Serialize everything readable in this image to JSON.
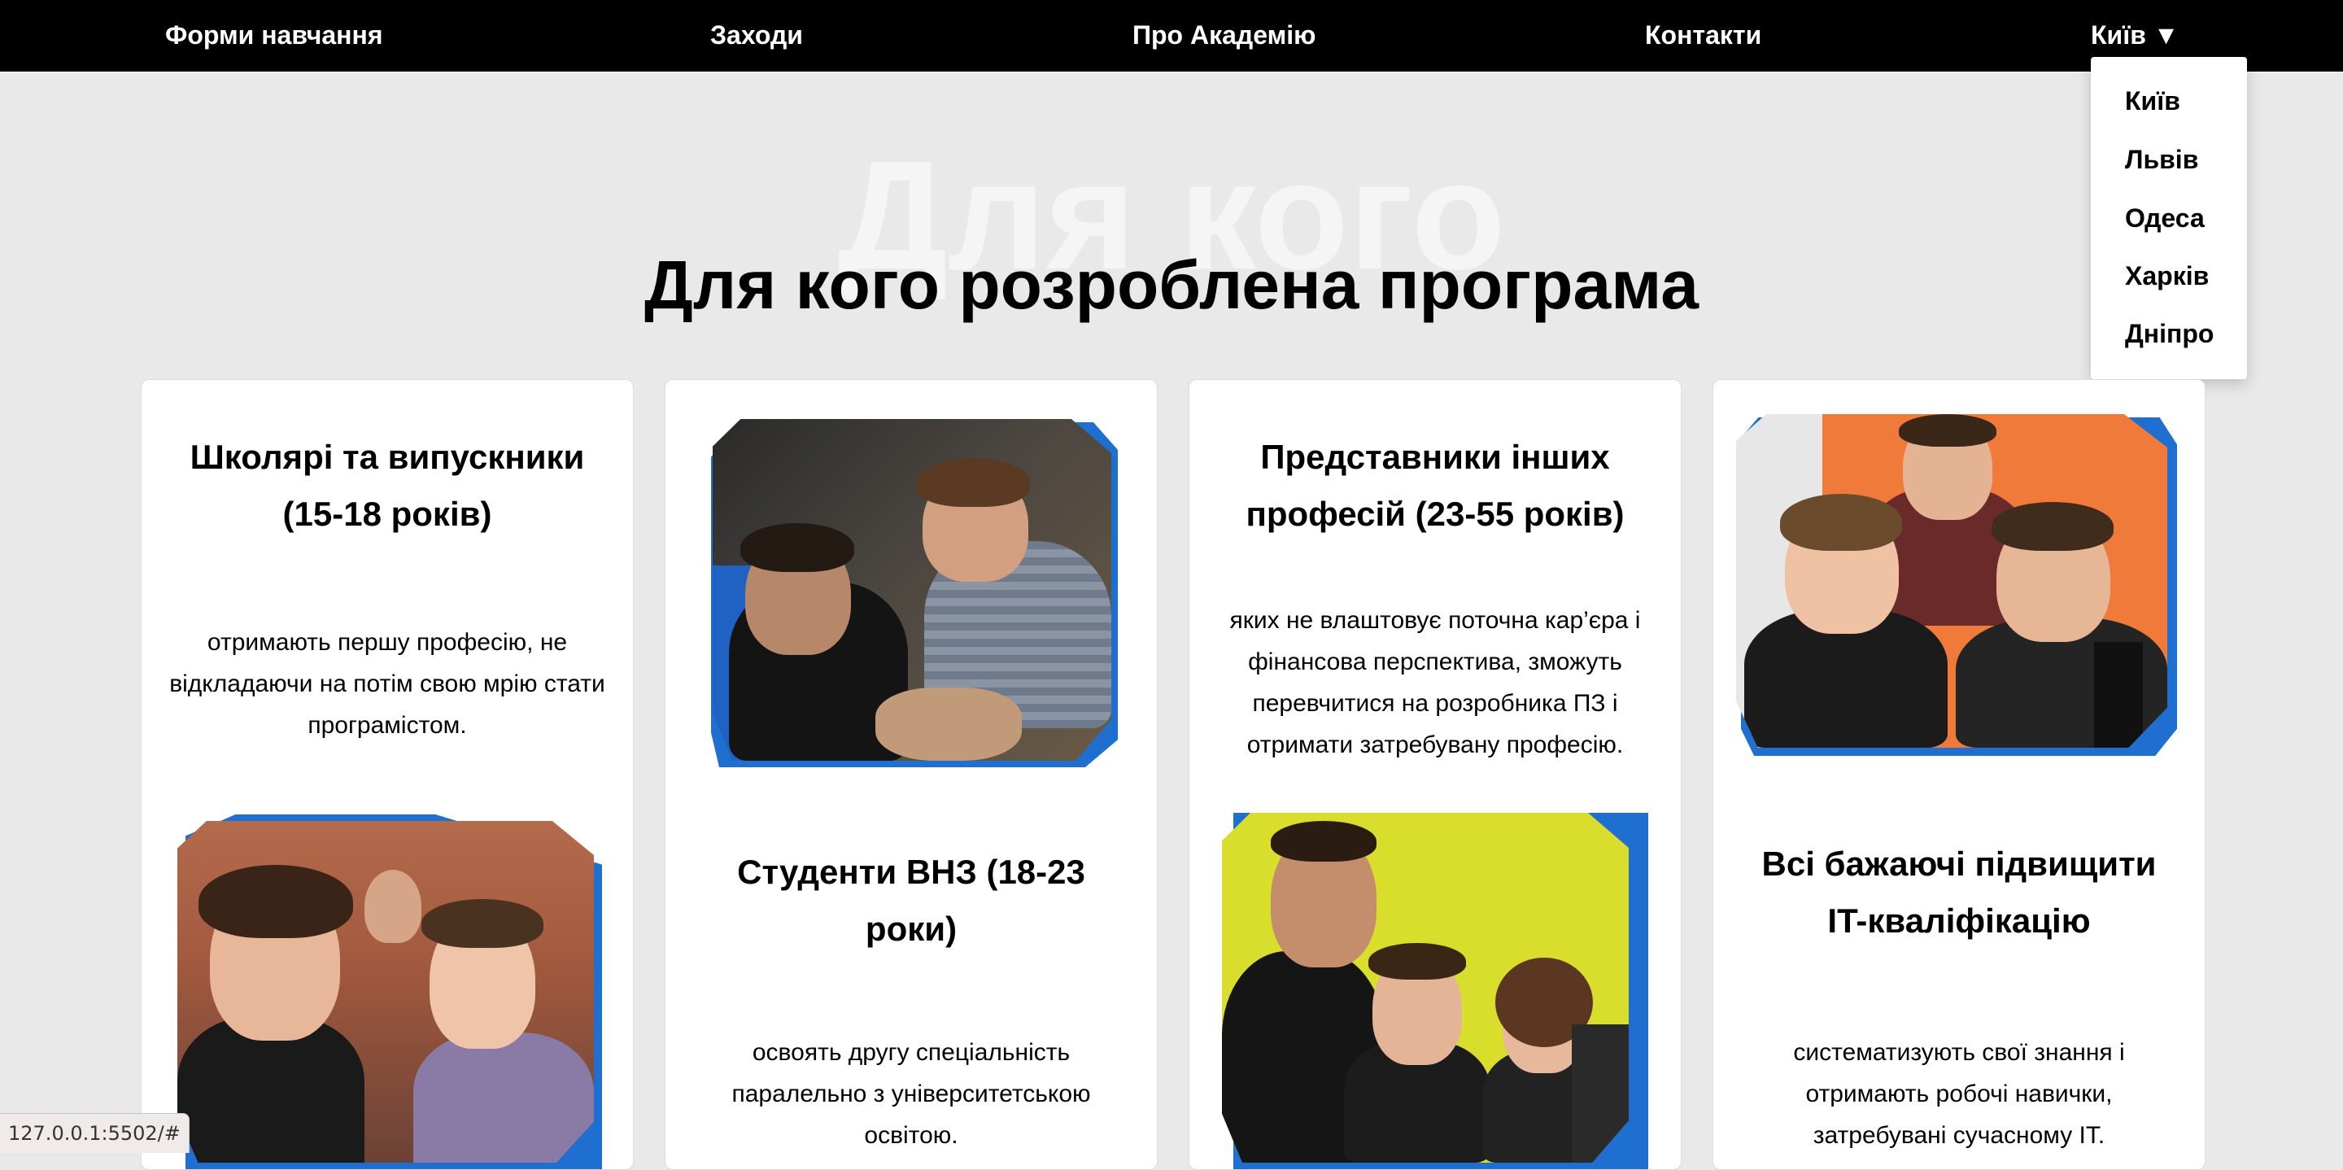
{
  "nav": {
    "items": [
      "Форми навчання",
      "Заходи",
      "Про Академію",
      "Контакти"
    ],
    "city_selector": "Київ ▼"
  },
  "city_dropdown": {
    "options": [
      "Київ",
      "Львів",
      "Одеса",
      "Харків",
      "Дніпро"
    ]
  },
  "section": {
    "background_title": "Для кого",
    "title": "Для кого розроблена програма"
  },
  "cards": [
    {
      "heading": "Школярі та випускники (15-18 років)",
      "text": "отримають першу професію, не відкладаючи на потім свою мрію стати програмістом.",
      "photo": "school-students-photo"
    },
    {
      "heading": "Студенти ВНЗ (18-23 роки)",
      "text": "освоять другу спеціальність паралельно з університетською освітою.",
      "photo": "university-students-photo"
    },
    {
      "heading": "Представники інших професій (23-55 років)",
      "text": "яких не влаштовує поточна кар’єра і фінансова перспектива, зможуть перевчитися на розробника ПЗ і отримати затребувану професію.",
      "photo": "professionals-photo"
    },
    {
      "heading": "Всі бажаючі підвищити IT-кваліфікацію",
      "text": "систематизують свої знання і отримають робочі навички, затребувані сучасному IT.",
      "photo": "it-learners-photo"
    }
  ],
  "status_bar": {
    "url": "127.0.0.1:5502/#"
  },
  "colors": {
    "nav_background": "#000000",
    "page_background": "#e9e9e9",
    "photo_accent": "#1f6fd0"
  }
}
